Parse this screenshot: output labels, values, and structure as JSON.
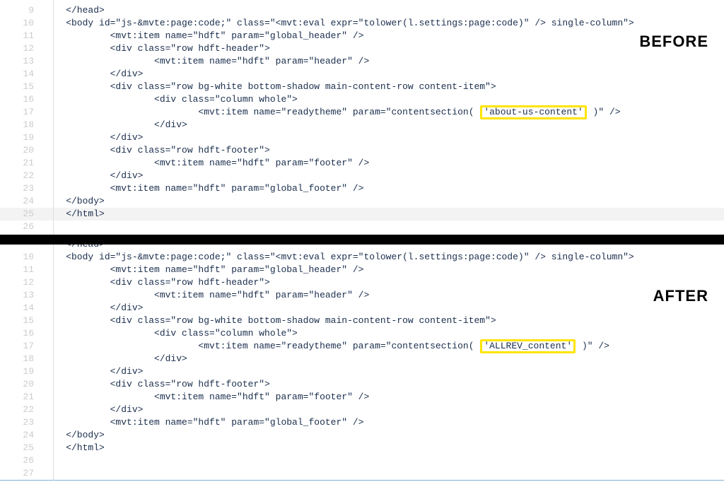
{
  "labels": {
    "before": "BEFORE",
    "after": "AFTER"
  },
  "highlights": {
    "before_value": "'about-us-content'",
    "after_value": "'ALLREV_content'"
  },
  "panes": {
    "before": {
      "start": 9,
      "lines": [
        {
          "n": "9",
          "t": "    </head>"
        },
        {
          "n": "10",
          "t": "    <body id=\"js-&mvte:page:code;\" class=\"<mvt:eval expr=\"tolower(l.settings:page:code)\" /> single-column\">"
        },
        {
          "n": "11",
          "t": "            <mvt:item name=\"hdft\" param=\"global_header\" />"
        },
        {
          "n": "12",
          "t": "            <div class=\"row hdft-header\">"
        },
        {
          "n": "13",
          "t": "                    <mvt:item name=\"hdft\" param=\"header\" />"
        },
        {
          "n": "14",
          "t": "            </div>"
        },
        {
          "n": "15",
          "t": "            <div class=\"row bg-white bottom-shadow main-content-row content-item\">"
        },
        {
          "n": "16",
          "t": "                    <div class=\"column whole\">"
        },
        {
          "n": "17",
          "pre": "                            <mvt:item name=\"readytheme\" param=\"contentsection( ",
          "hl": "before_value",
          "post": " )\" />"
        },
        {
          "n": "18",
          "t": "                    </div>"
        },
        {
          "n": "19",
          "t": "            </div>"
        },
        {
          "n": "20",
          "t": "            <div class=\"row hdft-footer\">"
        },
        {
          "n": "21",
          "t": "                    <mvt:item name=\"hdft\" param=\"footer\" />"
        },
        {
          "n": "22",
          "t": "            </div>"
        },
        {
          "n": "23",
          "t": "            <mvt:item name=\"hdft\" param=\"global_footer\" />"
        },
        {
          "n": "24",
          "t": "    </body>"
        },
        {
          "n": "25",
          "t": "    </html>",
          "row_hl": true
        },
        {
          "n": "26",
          "t": ""
        }
      ]
    },
    "after": {
      "start": 10,
      "truncated_top": {
        "n": "",
        "t": "    </head>"
      },
      "lines": [
        {
          "n": "10",
          "t": "    <body id=\"js-&mvte:page:code;\" class=\"<mvt:eval expr=\"tolower(l.settings:page:code)\" /> single-column\">"
        },
        {
          "n": "11",
          "t": "            <mvt:item name=\"hdft\" param=\"global_header\" />"
        },
        {
          "n": "12",
          "t": "            <div class=\"row hdft-header\">"
        },
        {
          "n": "13",
          "t": "                    <mvt:item name=\"hdft\" param=\"header\" />"
        },
        {
          "n": "14",
          "t": "            </div>"
        },
        {
          "n": "15",
          "t": "            <div class=\"row bg-white bottom-shadow main-content-row content-item\">"
        },
        {
          "n": "16",
          "t": "                    <div class=\"column whole\">"
        },
        {
          "n": "17",
          "pre": "                            <mvt:item name=\"readytheme\" param=\"contentsection( ",
          "hl": "after_value",
          "post": " )\" />"
        },
        {
          "n": "18",
          "t": "                    </div>"
        },
        {
          "n": "19",
          "t": "            </div>"
        },
        {
          "n": "20",
          "t": "            <div class=\"row hdft-footer\">"
        },
        {
          "n": "21",
          "t": "                    <mvt:item name=\"hdft\" param=\"footer\" />"
        },
        {
          "n": "22",
          "t": "            </div>"
        },
        {
          "n": "23",
          "t": "            <mvt:item name=\"hdft\" param=\"global_footer\" />"
        },
        {
          "n": "24",
          "t": "    </body>"
        },
        {
          "n": "25",
          "t": "    </html>"
        },
        {
          "n": "26",
          "t": ""
        },
        {
          "n": "27",
          "t": ""
        }
      ]
    }
  }
}
